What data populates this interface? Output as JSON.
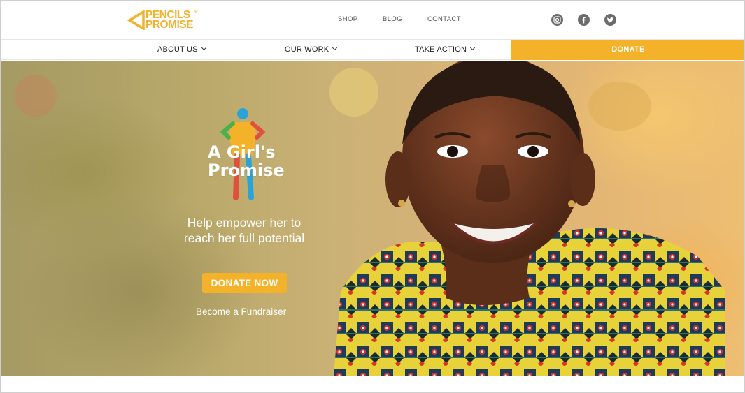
{
  "header": {
    "logo": {
      "line1": "PENCILS",
      "line2": "PROMISE",
      "small": "of"
    },
    "links": [
      "SHOP",
      "BLOG",
      "CONTACT"
    ],
    "social": [
      "instagram-icon",
      "facebook-icon",
      "twitter-icon"
    ]
  },
  "nav": {
    "items": [
      "ABOUT US",
      "OUR WORK",
      "TAKE ACTION"
    ],
    "donate": "DONATE"
  },
  "hero": {
    "campaign_logo": {
      "line1": "A Girl's",
      "line2": "Promise"
    },
    "tagline_line1": "Help empower her to",
    "tagline_line2": "reach her full potential",
    "cta": "DONATE NOW",
    "secondary_link": "Become a Fundraiser"
  },
  "colors": {
    "accent": "#f3b229",
    "icon_gray": "#6b6b6b"
  }
}
